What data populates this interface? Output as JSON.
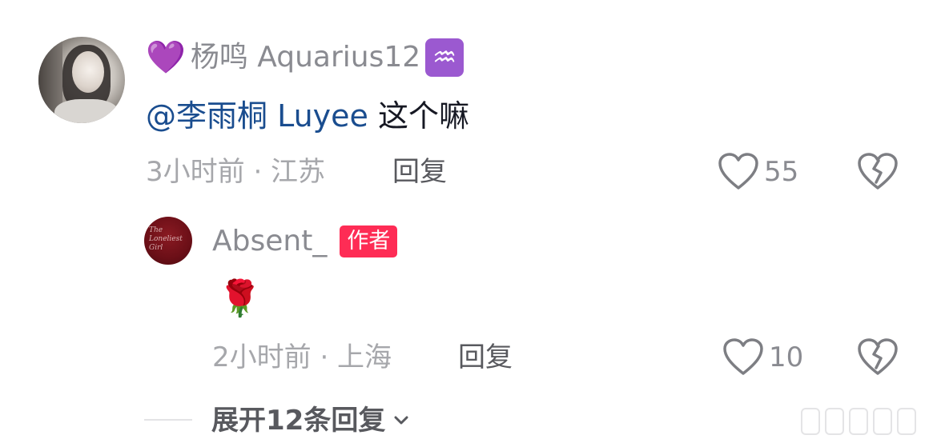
{
  "comment": {
    "emoji_prefix": "💜",
    "username": "杨鸣 Aquarius12",
    "zodiac_emoji": "♒",
    "mention": "@李雨桐 Luyee",
    "text": " 这个嘛",
    "time_location": "3小时前 · 江苏",
    "reply_label": "回复",
    "like_count": "55"
  },
  "reply": {
    "username": "Absent_",
    "badge": "作者",
    "avatar_script": "The Loneliest Girl",
    "text": "🌹",
    "time_location": "2小时前 · 上海",
    "reply_label": "回复",
    "like_count": "10"
  },
  "expand": {
    "label": "展开12条回复"
  },
  "colors": {
    "accent_badge": "#fe2c55",
    "mention": "#1a4d8f",
    "meta": "#a6a7ab"
  }
}
